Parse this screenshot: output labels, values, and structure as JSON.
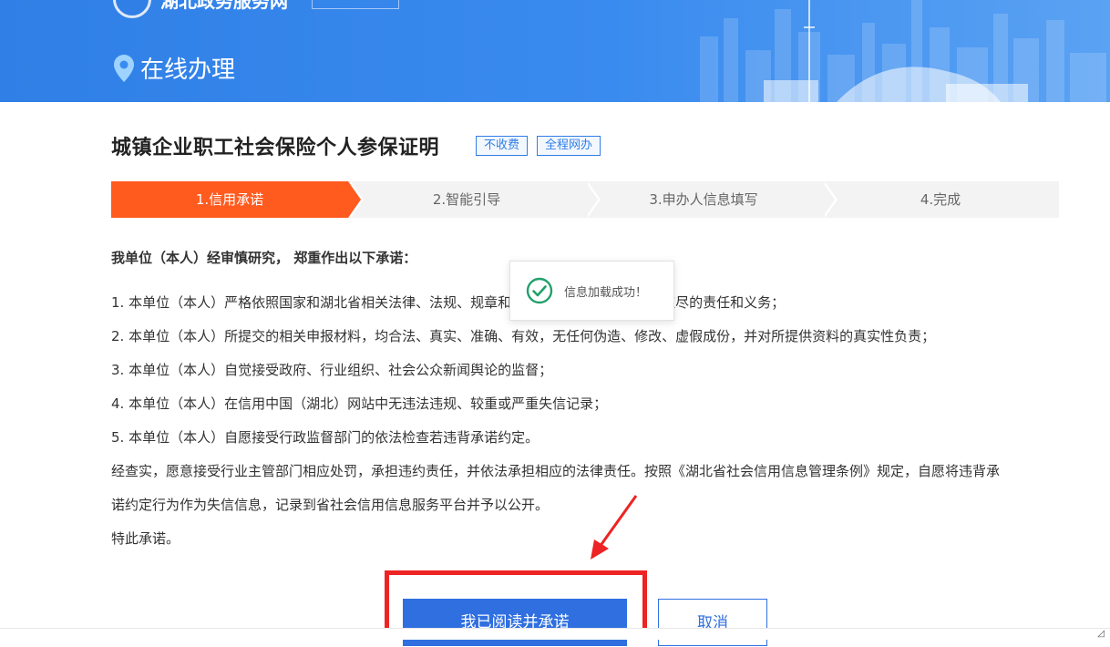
{
  "header": {
    "site_name": "湖北政务服务网",
    "section_title": "在线办理"
  },
  "service": {
    "title": "城镇企业职工社会保险个人参保证明",
    "tags": [
      "不收费",
      "全程网办"
    ]
  },
  "steps": [
    {
      "label": "1.信用承诺",
      "active": true
    },
    {
      "label": "2.智能引导",
      "active": false
    },
    {
      "label": "3.申办人信息填写",
      "active": false
    },
    {
      "label": "4.完成",
      "active": false
    }
  ],
  "commitment": {
    "heading": "我单位（本人）经审慎研究， 郑重作出以下承诺：",
    "items": [
      "1. 本单位（本人）严格依照国家和湖北省相关法律、法规、规章和规范性文件的要求，履行应尽的责任和义务；",
      "2. 本单位（本人）所提交的相关申报材料，均合法、真实、准确、有效，无任何伪造、修改、虚假成份，并对所提供资料的真实性负责；",
      "3. 本单位（本人）自觉接受政府、行业组织、社会公众新闻舆论的监督；",
      "4. 本单位（本人）在信用中国（湖北）网站中无违法违规、较重或严重失信记录；",
      "5. 本单位（本人）自愿接受行政监督部门的依法检查若违背承诺约定。"
    ],
    "closing_1": "经查实，愿意接受行业主管部门相应处罚，承担违约责任，并依法承担相应的法律责任。按照《湖北省社会信用信息管理条例》规定，自愿将违背承",
    "closing_2": "诺约定行为作为失信信息，记录到省社会信用信息服务平台并予以公开。",
    "closing_3": "特此承诺。"
  },
  "toast": {
    "message": "信息加载成功！",
    "icon": "check-circle-icon"
  },
  "actions": {
    "agree_label": "我已阅读并承诺",
    "cancel_label": "取消"
  },
  "colors": {
    "banner_blue": "#3a8bef",
    "active_step": "#ff5b1f",
    "primary_button": "#2f6fe0",
    "highlight_red": "#ee2323",
    "toast_check": "#22a06b"
  }
}
